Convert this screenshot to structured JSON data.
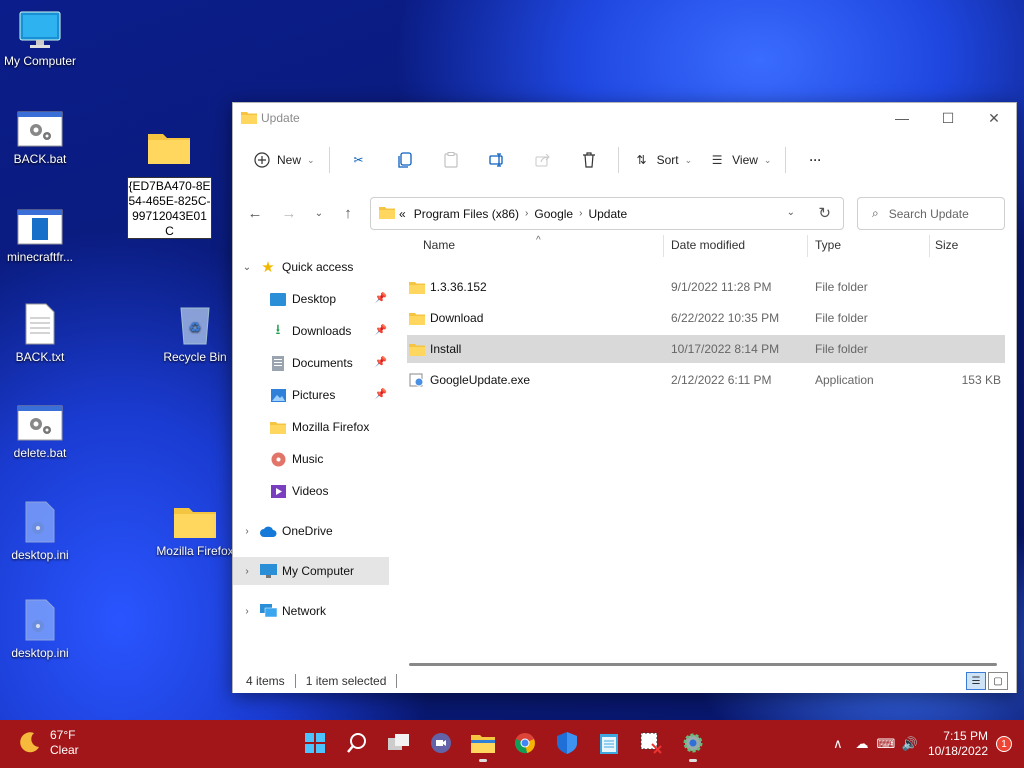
{
  "desktop": {
    "icons": [
      {
        "label": "My Computer"
      },
      {
        "label": "BACK.bat"
      },
      {
        "label": "minecraftfr..."
      },
      {
        "label": "BACK.txt"
      },
      {
        "label": "delete.bat"
      },
      {
        "label": "desktop.ini"
      },
      {
        "label": "desktop.ini"
      },
      {
        "label": "Recycle Bin"
      },
      {
        "label": "Mozilla Firefox"
      }
    ],
    "rename_text": "{ED7BA470-8E54-465E-825C-99712043E01C"
  },
  "window": {
    "title": "Update",
    "toolbar": {
      "new_label": "New",
      "sort_label": "Sort",
      "view_label": "View"
    },
    "address": {
      "overflow": "«",
      "crumbs": [
        "Program Files (x86)",
        "Google",
        "Update"
      ]
    },
    "search_placeholder": "Search Update",
    "sidebar": {
      "quick_access": "Quick access",
      "items": [
        {
          "label": "Desktop"
        },
        {
          "label": "Downloads"
        },
        {
          "label": "Documents"
        },
        {
          "label": "Pictures"
        },
        {
          "label": "Mozilla Firefox"
        },
        {
          "label": "Music"
        },
        {
          "label": "Videos"
        }
      ],
      "onedrive": "OneDrive",
      "my_computer": "My Computer",
      "network": "Network"
    },
    "columns": {
      "name": "Name",
      "date": "Date modified",
      "type": "Type",
      "size": "Size"
    },
    "files": [
      {
        "name": "1.3.36.152",
        "date": "9/1/2022 11:28 PM",
        "type": "File folder",
        "size": ""
      },
      {
        "name": "Download",
        "date": "6/22/2022 10:35 PM",
        "type": "File folder",
        "size": ""
      },
      {
        "name": "Install",
        "date": "10/17/2022 8:14 PM",
        "type": "File folder",
        "size": ""
      },
      {
        "name": "GoogleUpdate.exe",
        "date": "2/12/2022 6:11 PM",
        "type": "Application",
        "size": "153 KB"
      }
    ],
    "status": {
      "count": "4 items",
      "selected": "1 item selected"
    }
  },
  "taskbar": {
    "weather": {
      "temp": "67°F",
      "cond": "Clear"
    },
    "clock": {
      "time": "7:15 PM",
      "date": "10/18/2022"
    },
    "notifications": "1"
  },
  "colors": {
    "taskbar": "#a21619",
    "accent": "#0a5fbf",
    "folder": "#f5c542"
  }
}
